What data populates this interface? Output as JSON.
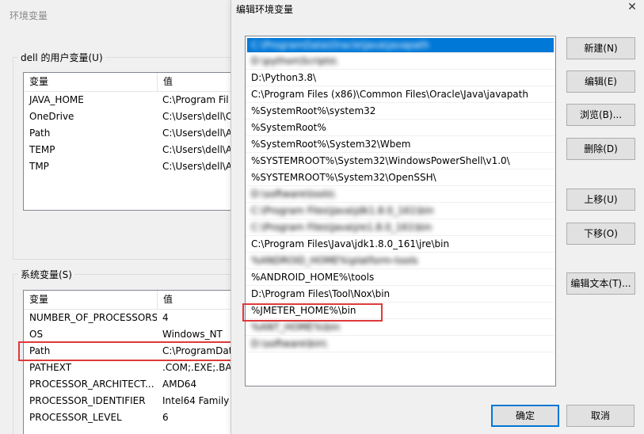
{
  "bg": {
    "title": "环境变量",
    "user_group_label": "dell 的用户变量(U)",
    "system_group_label": "系统变量(S)",
    "columns": {
      "variable": "变量",
      "value": "值"
    },
    "user_vars": [
      {
        "name": "JAVA_HOME",
        "value": "C:\\Program Fil"
      },
      {
        "name": "OneDrive",
        "value": "C:\\Users\\dell\\C"
      },
      {
        "name": "Path",
        "value": "C:\\Users\\dell\\A"
      },
      {
        "name": "TEMP",
        "value": "C:\\Users\\dell\\A"
      },
      {
        "name": "TMP",
        "value": "C:\\Users\\dell\\A"
      }
    ],
    "system_vars": [
      {
        "name": "NUMBER_OF_PROCESSORS",
        "value": "4"
      },
      {
        "name": "OS",
        "value": "Windows_NT"
      },
      {
        "name": "Path",
        "value": "C:\\ProgramDat"
      },
      {
        "name": "PATHEXT",
        "value": ".COM;.EXE;.BAT"
      },
      {
        "name": "PROCESSOR_ARCHITECT...",
        "value": "AMD64"
      },
      {
        "name": "PROCESSOR_IDENTIFIER",
        "value": "Intel64 Family"
      },
      {
        "name": "PROCESSOR_LEVEL",
        "value": "6"
      }
    ]
  },
  "dialog": {
    "title": "编辑环境变量",
    "close_glyph": "✕",
    "paths": [
      {
        "text": "C:\\ProgramData\\Oracle\\Java\\javapath",
        "blurred": true,
        "selected": true
      },
      {
        "text": "D:\\python\\Scripts\\",
        "blurred": true
      },
      {
        "text": "D:\\Python3.8\\"
      },
      {
        "text": "C:\\Program Files (x86)\\Common Files\\Oracle\\Java\\javapath"
      },
      {
        "text": "%SystemRoot%\\system32"
      },
      {
        "text": "%SystemRoot%"
      },
      {
        "text": "%SystemRoot%\\System32\\Wbem"
      },
      {
        "text": "%SYSTEMROOT%\\System32\\WindowsPowerShell\\v1.0\\"
      },
      {
        "text": "%SYSTEMROOT%\\System32\\OpenSSH\\"
      },
      {
        "text": "D:\\software\\tools\\",
        "blurred": true
      },
      {
        "text": "C:\\Program Files\\Java\\jdk1.8.0_161\\bin",
        "blurred": true
      },
      {
        "text": "C:\\Program Files\\Java\\jre1.8.0_161\\bin",
        "blurred": true
      },
      {
        "text": "C:\\Program Files\\Java\\jdk1.8.0_161\\jre\\bin"
      },
      {
        "text": "%ANDROID_HOME%\\platform-tools",
        "blurred": true
      },
      {
        "text": "%ANDROID_HOME%\\tools"
      },
      {
        "text": "D:\\Program Files\\Tool\\Nox\\bin"
      },
      {
        "text": "%JMETER_HOME%\\bin"
      },
      {
        "text": "%ANT_HOME%\\bin",
        "blurred": true
      },
      {
        "text": "D:\\software\\bin\\",
        "blurred": true
      }
    ],
    "buttons": {
      "new": "新建(N)",
      "edit": "编辑(E)",
      "browse": "浏览(B)...",
      "delete": "删除(D)",
      "move_up": "上移(U)",
      "move_down": "下移(O)",
      "edit_text": "编辑文本(T)...",
      "ok": "确定",
      "cancel": "取消"
    },
    "highlight_color": "#e0393a",
    "selection_color": "#0078d7"
  }
}
